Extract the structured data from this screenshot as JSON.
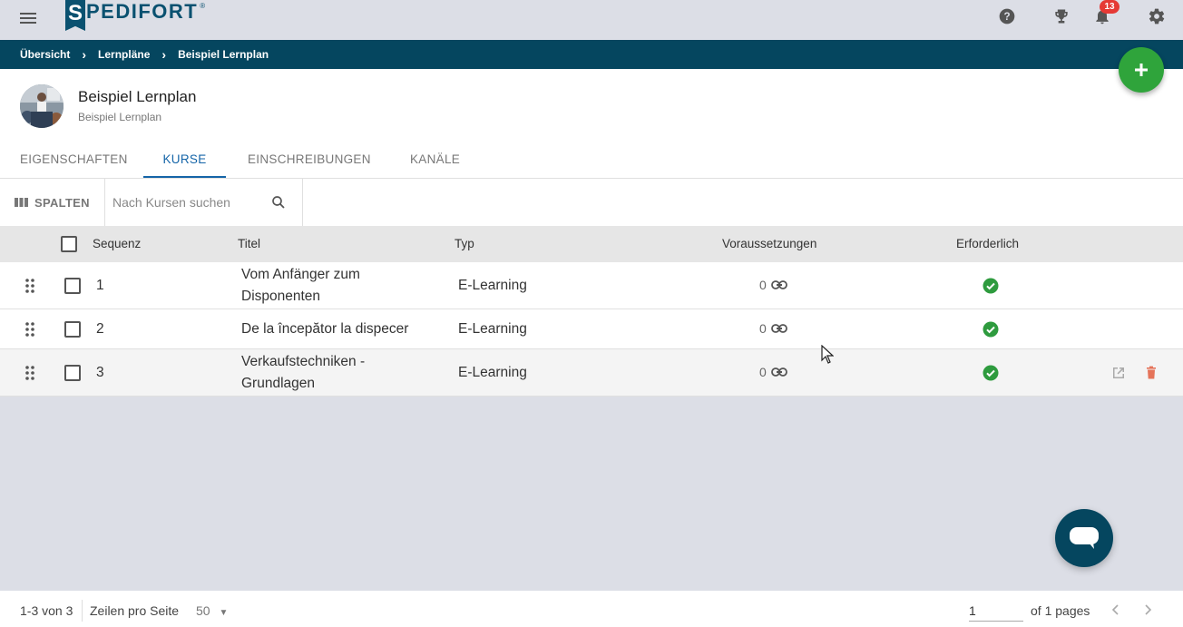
{
  "topbar": {
    "logo_initial": "S",
    "logo_text": "PEDIFORT",
    "logo_reg": "®",
    "notifications_count": "13",
    "icons": [
      "menu-icon",
      "help-icon",
      "trophy-icon",
      "bell-icon",
      "gear-icon"
    ]
  },
  "breadcrumb": {
    "items": [
      "Übersicht",
      "Lernpläne",
      "Beispiel Lernplan"
    ]
  },
  "header": {
    "title": "Beispiel Lernplan",
    "subtitle": "Beispiel Lernplan"
  },
  "tabs": [
    {
      "label": "EIGENSCHAFTEN",
      "active": false
    },
    {
      "label": "KURSE",
      "active": true
    },
    {
      "label": "EINSCHREIBUNGEN",
      "active": false
    },
    {
      "label": "KANÄLE",
      "active": false
    }
  ],
  "toolbar": {
    "columns_label": "SPALTEN",
    "search_placeholder": "Nach Kursen suchen",
    "search_value": ""
  },
  "table": {
    "headers": [
      "Sequenz",
      "Titel",
      "Typ",
      "Voraussetzungen",
      "Erforderlich"
    ],
    "rows": [
      {
        "sequence": "1",
        "title_line1": "Vom Anfänger zum",
        "title_line2": "Disponenten",
        "type": "E-Learning",
        "prerequisites": "0",
        "required": true,
        "checked": false
      },
      {
        "sequence": "2",
        "title_line1": "De la începător la dispecer",
        "title_line2": "",
        "type": "E-Learning",
        "prerequisites": "0",
        "required": true,
        "checked": false
      },
      {
        "sequence": "3",
        "title_line1": "Verkaufstechniken -",
        "title_line2": "Grundlagen",
        "type": "E-Learning",
        "prerequisites": "0",
        "required": true,
        "checked": false
      }
    ]
  },
  "footer": {
    "range": "1-3 von 3",
    "rows_per_page_label": "Zeilen pro Seite",
    "rows_per_page_value": "50",
    "page_value": "1",
    "page_total": "of 1 pages"
  },
  "colors": {
    "brand": "#05465f",
    "accent_tab": "#1565a8",
    "fab_green": "#2fa43b",
    "check_green": "#2e9b3e",
    "badge_red": "#e53935",
    "delete_red": "#e57359"
  }
}
